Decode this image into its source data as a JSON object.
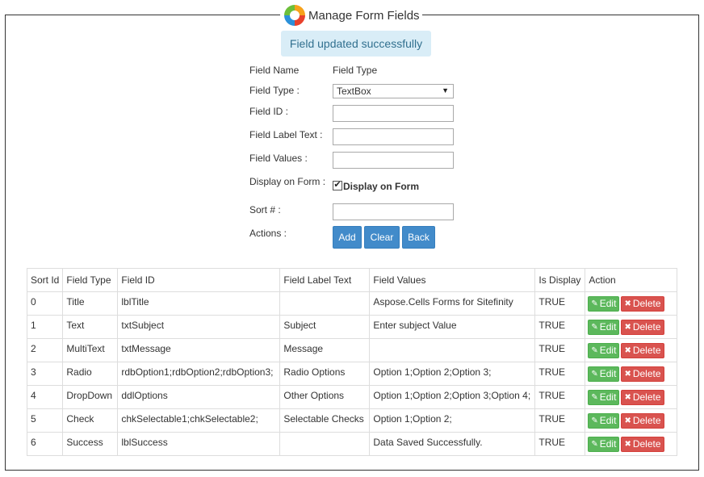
{
  "header": {
    "title": "Manage Form Fields"
  },
  "alert": {
    "message": "Field updated successfully"
  },
  "form": {
    "field_name_label": "Field Name",
    "field_name_value": "Field Type",
    "field_type_label": "Field Type :",
    "field_type_selected": "TextBox",
    "field_id_label": "Field ID :",
    "field_id_value": "",
    "field_label_text_label": "Field Label Text :",
    "field_label_text_value": "",
    "field_values_label": "Field Values :",
    "field_values_value": "",
    "display_on_form_label": "Display on Form :",
    "display_on_form_checkbox_label": "Display on Form",
    "display_on_form_checked": true,
    "sort_label": "Sort # :",
    "sort_value": "",
    "actions_label": "Actions :",
    "add_label": "Add",
    "clear_label": "Clear",
    "back_label": "Back"
  },
  "table": {
    "headers": [
      "Sort Id",
      "Field Type",
      "Field ID",
      "Field Label Text",
      "Field Values",
      "Is Display",
      "Action"
    ],
    "edit_label": "Edit",
    "delete_label": "Delete",
    "rows": [
      [
        "0",
        "Title",
        "lblTitle",
        "",
        "Aspose.Cells Forms for Sitefinity",
        "TRUE"
      ],
      [
        "1",
        "Text",
        "txtSubject",
        "Subject",
        "Enter subject Value",
        "TRUE"
      ],
      [
        "2",
        "MultiText",
        "txtMessage",
        "Message",
        "",
        "TRUE"
      ],
      [
        "3",
        "Radio",
        "rdbOption1;rdbOption2;rdbOption3;",
        "Radio Options",
        "Option 1;Option 2;Option 3;",
        "TRUE"
      ],
      [
        "4",
        "DropDown",
        "ddlOptions",
        "Other Options",
        "Option 1;Option 2;Option 3;Option 4;",
        "TRUE"
      ],
      [
        "5",
        "Check",
        "chkSelectable1;chkSelectable2;",
        "Selectable Checks",
        "Option 1;Option 2;",
        "TRUE"
      ],
      [
        "6",
        "Success",
        "lblSuccess",
        "",
        "Data Saved Successfully.",
        "TRUE"
      ]
    ]
  },
  "colors": {
    "primary": "#428bca",
    "success": "#5cb85c",
    "danger": "#d9534f",
    "alert_bg": "#d9edf7",
    "alert_text": "#31708f"
  },
  "icons": {
    "logo": "aspose-logo-icon",
    "edit": "edit-icon",
    "delete": "close-icon",
    "dropdown": "caret-down-icon",
    "check": "checkmark-icon"
  }
}
